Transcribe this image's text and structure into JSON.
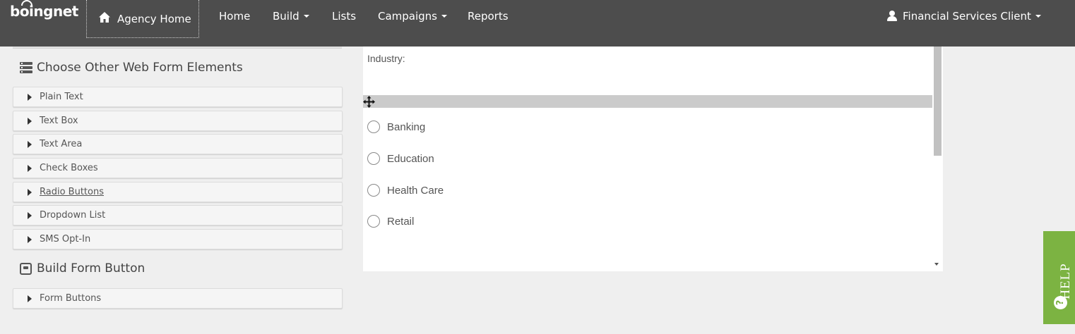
{
  "brand": {
    "logo_text": "boingnet"
  },
  "nav": {
    "agency_home": "Agency Home",
    "items": [
      {
        "label": "Home",
        "has_dropdown": false
      },
      {
        "label": "Build",
        "has_dropdown": true
      },
      {
        "label": "Lists",
        "has_dropdown": false
      },
      {
        "label": "Campaigns",
        "has_dropdown": true
      },
      {
        "label": "Reports",
        "has_dropdown": false
      }
    ],
    "user": "Financial Services Client"
  },
  "sidebar": {
    "other_elements_heading": "Choose Other Web Form Elements",
    "elements": [
      {
        "label": "Plain Text"
      },
      {
        "label": "Text Box"
      },
      {
        "label": "Text Area"
      },
      {
        "label": "Check Boxes"
      },
      {
        "label": "Radio Buttons",
        "hovered": true
      },
      {
        "label": "Dropdown List"
      },
      {
        "label": "SMS Opt-In"
      }
    ],
    "build_button_heading": "Build Form Button",
    "button_items": [
      {
        "label": "Form Buttons"
      }
    ]
  },
  "preview": {
    "field_label": "Industry:",
    "options": [
      {
        "label": "Banking",
        "selected": false
      },
      {
        "label": "Education",
        "selected": false
      },
      {
        "label": "Health Care",
        "selected": false
      },
      {
        "label": "Retail",
        "selected": false
      }
    ]
  },
  "help": {
    "label": "HELP",
    "icon": "?"
  },
  "icons": {
    "agency_home": "home-icon",
    "user": "user-icon",
    "other_elements": "list-icon",
    "build_button": "button-icon",
    "drag": "move-icon",
    "help": "help-circle-icon"
  },
  "colors": {
    "nav_bg": "#4d4d4d",
    "page_bg": "#efefef",
    "help_bg": "#7cb342",
    "drag_bar": "#cbcbcb"
  }
}
